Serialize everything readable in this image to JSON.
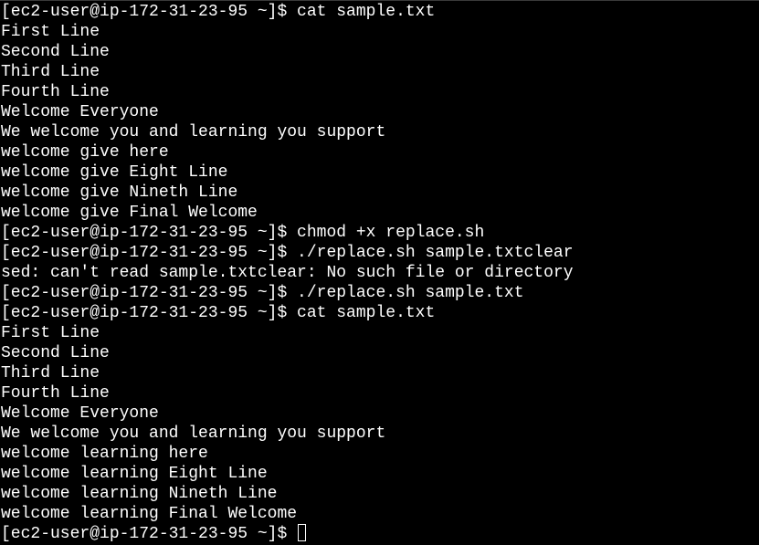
{
  "colors": {
    "background": "#000000",
    "foreground": "#ffffff"
  },
  "terminal": {
    "lines": [
      "[ec2-user@ip-172-31-23-95 ~]$ cat sample.txt",
      "First Line",
      "Second Line",
      "Third Line",
      "Fourth Line",
      "Welcome Everyone",
      "We welcome you and learning you support",
      "welcome give here",
      "welcome give Eight Line",
      "welcome give Nineth Line",
      "welcome give Final Welcome",
      "[ec2-user@ip-172-31-23-95 ~]$ chmod +x replace.sh",
      "[ec2-user@ip-172-31-23-95 ~]$ ./replace.sh sample.txtclear",
      "sed: can't read sample.txtclear: No such file or directory",
      "[ec2-user@ip-172-31-23-95 ~]$ ./replace.sh sample.txt",
      "[ec2-user@ip-172-31-23-95 ~]$ cat sample.txt",
      "First Line",
      "Second Line",
      "Third Line",
      "Fourth Line",
      "Welcome Everyone",
      "We welcome you and learning you support",
      "welcome learning here",
      "welcome learning Eight Line",
      "welcome learning Nineth Line",
      "welcome learning Final Welcome"
    ],
    "prompt": "[ec2-user@ip-172-31-23-95 ~]$ "
  }
}
